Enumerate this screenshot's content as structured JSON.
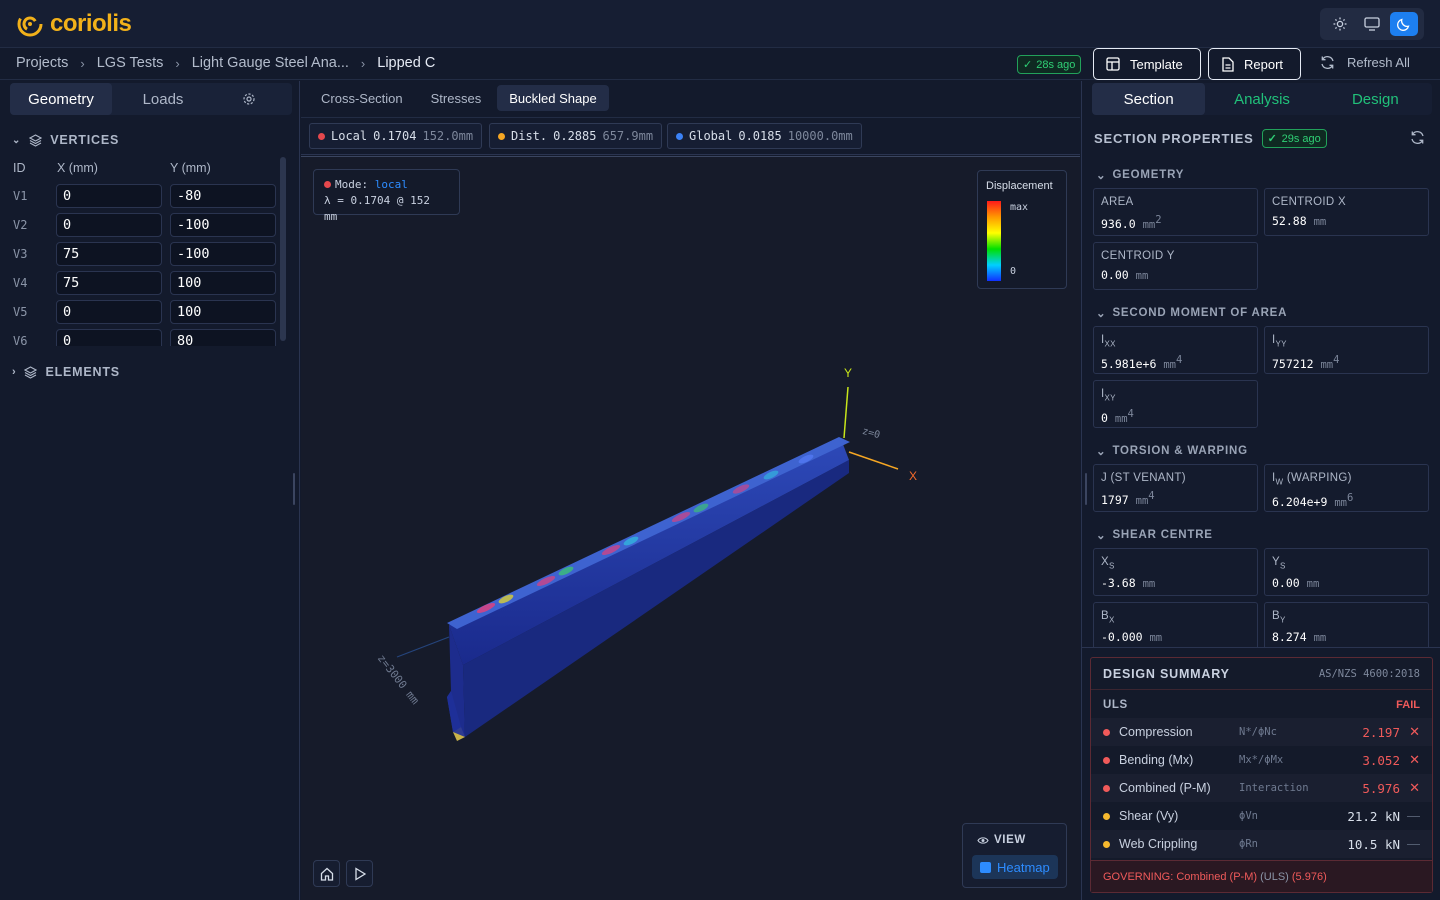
{
  "app": {
    "name": "coriolis"
  },
  "breadcrumb": [
    "Projects",
    "LGS Tests",
    "Light Gauge Steel Ana...",
    "Lipped C"
  ],
  "header": {
    "updated_badge": "28s ago",
    "template_label": "Template",
    "report_label": "Report",
    "refresh_all_label": "Refresh All"
  },
  "left": {
    "tabs": [
      "Geometry",
      "Loads"
    ],
    "vertices_title": "VERTICES",
    "elements_title": "ELEMENTS",
    "columns": [
      "ID",
      "X (mm)",
      "Y (mm)"
    ],
    "vertices": [
      {
        "id": "V1",
        "x": "0",
        "y": "-80"
      },
      {
        "id": "V2",
        "x": "0",
        "y": "-100"
      },
      {
        "id": "V3",
        "x": "75",
        "y": "-100"
      },
      {
        "id": "V4",
        "x": "75",
        "y": "100"
      },
      {
        "id": "V5",
        "x": "0",
        "y": "100"
      },
      {
        "id": "V6",
        "x": "0",
        "y": "80"
      }
    ]
  },
  "center": {
    "tabs": [
      "Cross-Section",
      "Stresses",
      "Buckled Shape"
    ],
    "active_tab": "Buckled Shape",
    "modes": [
      {
        "name": "Local",
        "value": "0.1704",
        "length": "152.0mm",
        "color": "#e5484d"
      },
      {
        "name": "Dist.",
        "value": "0.2885",
        "length": "657.9mm",
        "color": "#f5a623"
      },
      {
        "name": "Global",
        "value": "0.0185",
        "length": "10000.0mm",
        "color": "#3b82f6"
      }
    ],
    "mode_box": {
      "mode_label": "Mode:",
      "mode_value": "local",
      "lambda_line": "λ = 0.1704 @ 152 mm"
    },
    "legend": {
      "title": "Displacement",
      "max": "max",
      "min": "0"
    },
    "axes": {
      "y": "Y",
      "x": "X",
      "z_label": "z=0",
      "length_label": "z=3000 mm"
    },
    "view": {
      "title": "VIEW",
      "heatmap": "Heatmap"
    }
  },
  "right": {
    "tabs": [
      "Section",
      "Analysis",
      "Design"
    ],
    "title": "SECTION PROPERTIES",
    "badge": "29s ago",
    "geometry": {
      "title": "GEOMETRY",
      "area_label": "AREA",
      "area_value": "936.0",
      "area_unit": "mm",
      "cx_label": "CENTROID X",
      "cx_value": "52.88",
      "cx_unit": "mm",
      "cy_label": "CENTROID Y",
      "cy_value": "0.00",
      "cy_unit": "mm"
    },
    "moment": {
      "title": "SECOND MOMENT OF AREA",
      "ixx_value": "5.981e+6",
      "iyy_value": "757212",
      "ixy_value": "0",
      "unit": "mm"
    },
    "torsion": {
      "title": "TORSION & WARPING",
      "j_label": "J (ST VENANT)",
      "j_value": "1797",
      "iw_label": "(WARPING)",
      "iw_value": "6.204e+9",
      "unit": "mm"
    },
    "shear": {
      "title": "SHEAR CENTRE",
      "xs_value": "-3.68",
      "ys_value": "0.00",
      "bx_value": "-0.000",
      "by_value": "8.274",
      "unit": "mm"
    },
    "design": {
      "title": "DESIGN SUMMARY",
      "standard": "AS/NZS 4600:2018",
      "uls_label": "ULS",
      "uls_status": "FAIL",
      "rows": [
        {
          "name": "Compression",
          "eq": "N*/ϕNc",
          "value": "2.197",
          "status": "fail"
        },
        {
          "name": "Bending (Mx)",
          "eq": "Mx*/ϕMx",
          "value": "3.052",
          "status": "fail"
        },
        {
          "name": "Combined (P-M)",
          "eq": "Interaction",
          "value": "5.976",
          "status": "fail"
        },
        {
          "name": "Shear (Vy)",
          "eq": "ϕVn",
          "value": "21.2 kN",
          "status": "info"
        },
        {
          "name": "Web Crippling",
          "eq": "ϕRn",
          "value": "10.5 kN",
          "status": "info"
        }
      ],
      "governing_prefix": "GOVERNING: Combined (P-M)",
      "governing_type": "(ULS)",
      "governing_value": "(5.976)"
    }
  }
}
